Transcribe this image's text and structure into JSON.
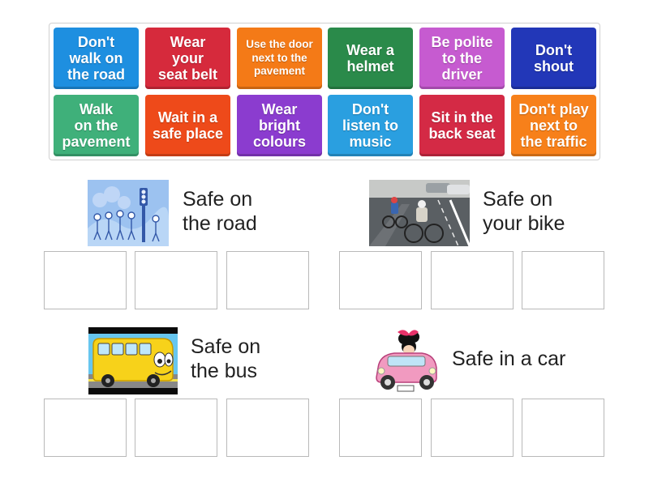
{
  "tiles": [
    {
      "label": "Don't\nwalk on\nthe road",
      "color": "#1e8fe0"
    },
    {
      "label": "Wear\nyour\nseat belt",
      "color": "#d62a3c"
    },
    {
      "label": "Use the door\nnext to the\npavement",
      "color": "#f47a17"
    },
    {
      "label": "Wear a\nhelmet",
      "color": "#2a8a4a"
    },
    {
      "label": "Be polite\nto the\ndriver",
      "color": "#c65bd0"
    },
    {
      "label": "Don't\nshout",
      "color": "#2237b8"
    },
    {
      "label": "Walk\non the\npavement",
      "color": "#3fb07a"
    },
    {
      "label": "Wait in a\nsafe place",
      "color": "#ee4a1a"
    },
    {
      "label": "Wear\nbright\ncolours",
      "color": "#8b3ccf"
    },
    {
      "label": "Don't\nlisten to\nmusic",
      "color": "#2a9fe0"
    },
    {
      "label": "Sit in the\nback seat",
      "color": "#d42a45"
    },
    {
      "label": "Don't play\nnext to\nthe traffic",
      "color": "#f7801a"
    }
  ],
  "groups": [
    {
      "title": "Safe on\nthe road",
      "image_icon": "pedestrian-crossing-icon"
    },
    {
      "title": "Safe on\nyour bike",
      "image_icon": "cyclists-photo-icon"
    },
    {
      "title": "Safe on\nthe bus",
      "image_icon": "cartoon-bus-icon"
    },
    {
      "title": "Safe in a car",
      "image_icon": "cartoon-car-icon"
    }
  ]
}
